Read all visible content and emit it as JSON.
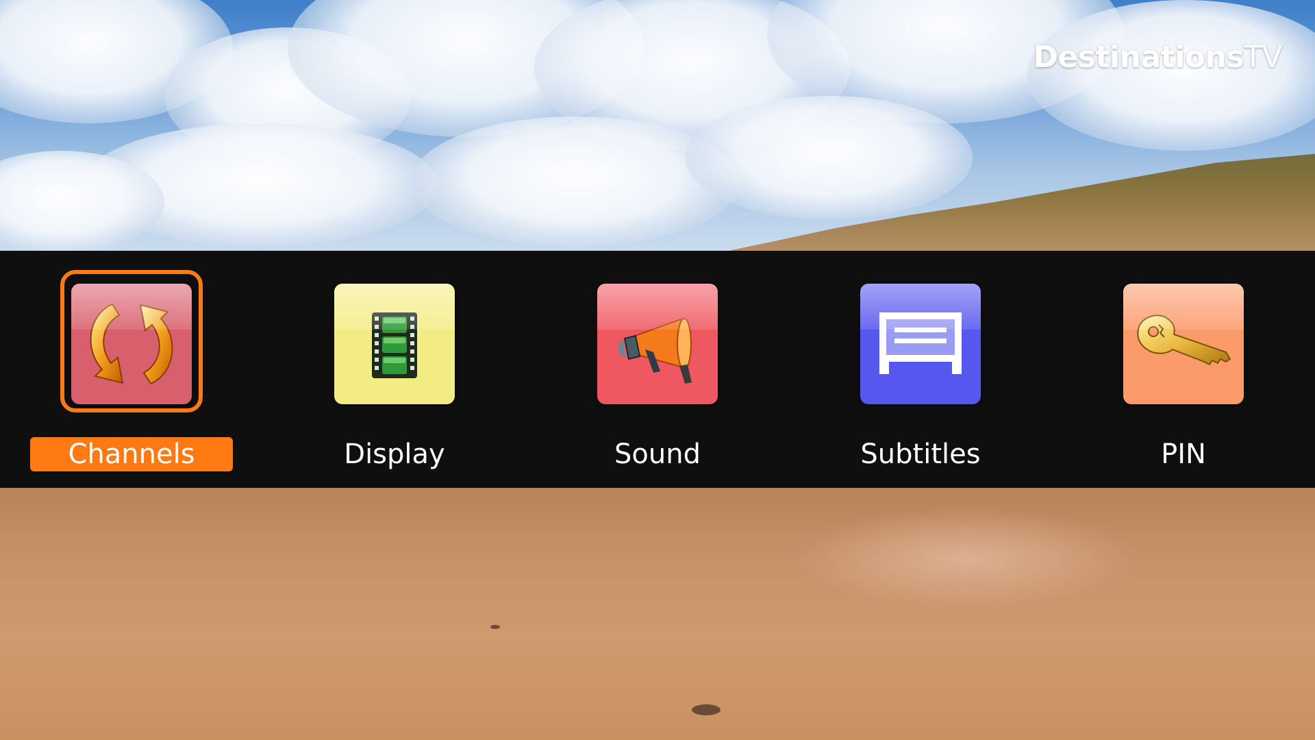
{
  "brand": {
    "name_main": "Destinations",
    "name_suffix": "TV"
  },
  "colors": {
    "accent": "#ff7a12",
    "menu_band": "#000000",
    "text": "#ffffff"
  },
  "menu": {
    "selected_index": 0,
    "items": [
      {
        "label": "Channels",
        "icon": "refresh-arrows-icon",
        "tile_color": "#e06b78"
      },
      {
        "label": "Display",
        "icon": "film-strip-icon",
        "tile_color": "#f6ef8a"
      },
      {
        "label": "Sound",
        "icon": "megaphone-icon",
        "tile_color": "#f25b63"
      },
      {
        "label": "Subtitles",
        "icon": "subtitles-icon",
        "tile_color": "#5b5cf0"
      },
      {
        "label": "PIN",
        "icon": "key-icon",
        "tile_color": "#fb9c6c"
      }
    ]
  }
}
